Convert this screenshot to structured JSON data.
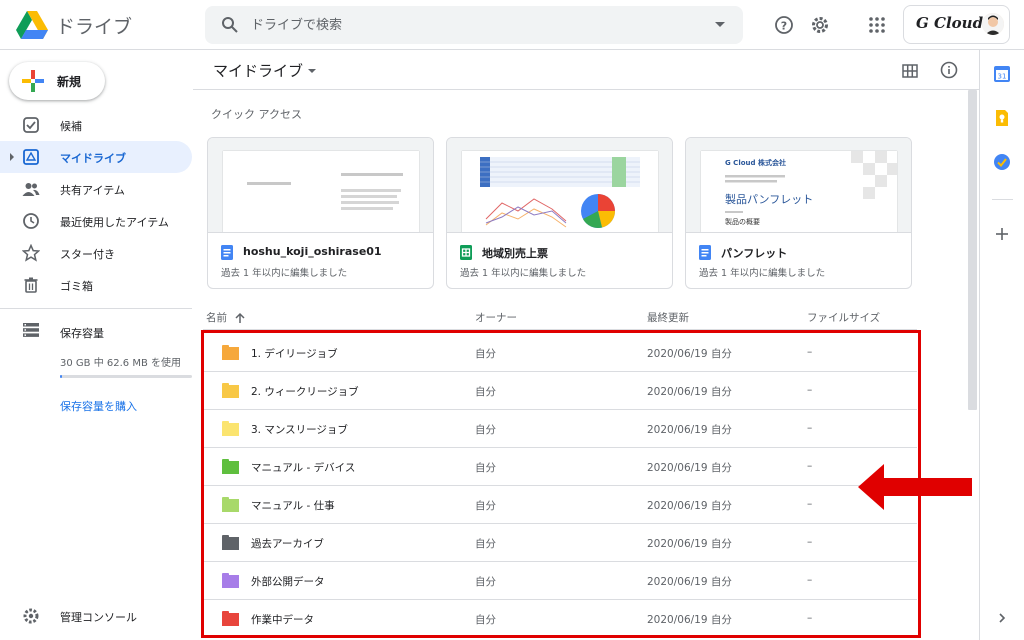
{
  "header": {
    "app_title": "ドライブ",
    "search_placeholder": "ドライブで検索",
    "brand": "G Cloud"
  },
  "sidebar": {
    "new_label": "新規",
    "items": [
      {
        "label": "候補",
        "icon": "checkbox-icon"
      },
      {
        "label": "マイドライブ",
        "icon": "my-drive-icon",
        "active": true
      },
      {
        "label": "共有アイテム",
        "icon": "people-icon"
      },
      {
        "label": "最近使用したアイテム",
        "icon": "clock-icon"
      },
      {
        "label": "スター付き",
        "icon": "star-icon"
      },
      {
        "label": "ゴミ箱",
        "icon": "trash-icon"
      }
    ],
    "storage": {
      "label": "保存容量",
      "usage": "30 GB 中 62.6 MB を使用",
      "fraction": 0.01,
      "buy_label": "保存容量を購入"
    },
    "admin_label": "管理コンソール"
  },
  "main": {
    "breadcrumb": "マイドライブ",
    "quick_access_label": "クイック アクセス",
    "quick_access": [
      {
        "name": "hoshu_koji_oshirase01",
        "sub": "過去 1 年以内に編集しました",
        "type": "doc"
      },
      {
        "name": "地域別売上票",
        "sub": "過去 1 年以内に編集しました",
        "type": "sheet"
      },
      {
        "name": "パンフレット",
        "sub": "過去 1 年以内に編集しました",
        "type": "doc"
      }
    ],
    "thumb_text": {
      "company": "G Cloud 株式会社",
      "title": "製品パンフレット",
      "section": "製品の概要"
    },
    "columns": {
      "name": "名前",
      "owner": "オーナー",
      "modified": "最終更新",
      "size": "ファイルサイズ"
    },
    "files": [
      {
        "name": "1. デイリージョブ",
        "owner": "自分",
        "modified": "2020/06/19 自分",
        "size": "–",
        "color": "#f6a83b"
      },
      {
        "name": "2. ウィークリージョブ",
        "owner": "自分",
        "modified": "2020/06/19 自分",
        "size": "–",
        "color": "#f8c846"
      },
      {
        "name": "3. マンスリージョブ",
        "owner": "自分",
        "modified": "2020/06/19 自分",
        "size": "–",
        "color": "#fbe46f"
      },
      {
        "name": "マニュアル - デバイス",
        "owner": "自分",
        "modified": "2020/06/19 自分",
        "size": "–",
        "color": "#5fbf3e"
      },
      {
        "name": "マニュアル - 仕事",
        "owner": "自分",
        "modified": "2020/06/19 自分",
        "size": "–",
        "color": "#a8d96a"
      },
      {
        "name": "過去アーカイブ",
        "owner": "自分",
        "modified": "2020/06/19 自分",
        "size": "–",
        "color": "#5f6368"
      },
      {
        "name": "外部公開データ",
        "owner": "自分",
        "modified": "2020/06/19 自分",
        "size": "–",
        "color": "#a77de8"
      },
      {
        "name": "作業中データ",
        "owner": "自分",
        "modified": "2020/06/19 自分",
        "size": "–",
        "color": "#e8453c"
      }
    ]
  },
  "colors": {
    "accent": "#1a73e8",
    "highlight": "#e00000"
  }
}
